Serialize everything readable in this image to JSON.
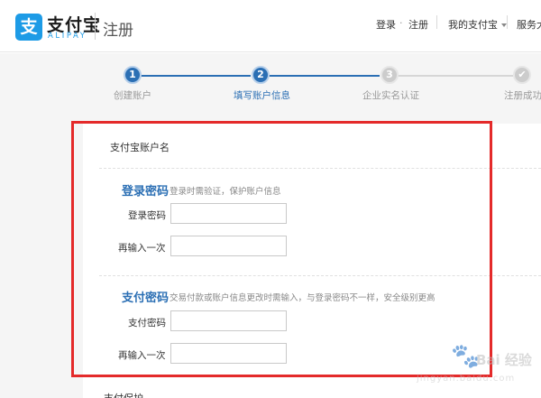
{
  "brand": {
    "logo_glyph": "支",
    "name_cn": "支付宝",
    "name_en": "ALIPAY",
    "color": "#1d9be6"
  },
  "header": {
    "page_title": "注册",
    "nav": {
      "login": "登录",
      "dot": "·",
      "register": "注册",
      "my_alipay": "我的支付宝",
      "service": "服务大厅"
    }
  },
  "steps": [
    {
      "number": "1",
      "label": "创建账户",
      "state": "done"
    },
    {
      "number": "2",
      "label": "填写账户信息",
      "state": "active"
    },
    {
      "number": "3",
      "label": "企业实名认证",
      "state": "todo"
    },
    {
      "number": "✔",
      "label": "注册成功",
      "state": "todo"
    }
  ],
  "form": {
    "account_name_label": "支付宝账户名",
    "login_password": {
      "title": "登录密码",
      "desc": "登录时需验证，保护账户信息",
      "password_label": "登录密码",
      "confirm_label": "再输入一次",
      "password_value": "",
      "confirm_value": ""
    },
    "pay_password": {
      "title": "支付密码",
      "desc": "交易付款或账户信息更改时需输入，与登录密码不一样，安全级别更高",
      "password_label": "支付密码",
      "confirm_label": "再输入一次",
      "password_value": "",
      "confirm_value": ""
    }
  },
  "bottom_partial": "支付保护",
  "watermark": {
    "text": "Bai 经验",
    "url": "jingyan.baidu.com"
  },
  "colors": {
    "accent": "#2b6fb4",
    "annotation": "#e42a2a",
    "inactive": "#cccccc"
  }
}
